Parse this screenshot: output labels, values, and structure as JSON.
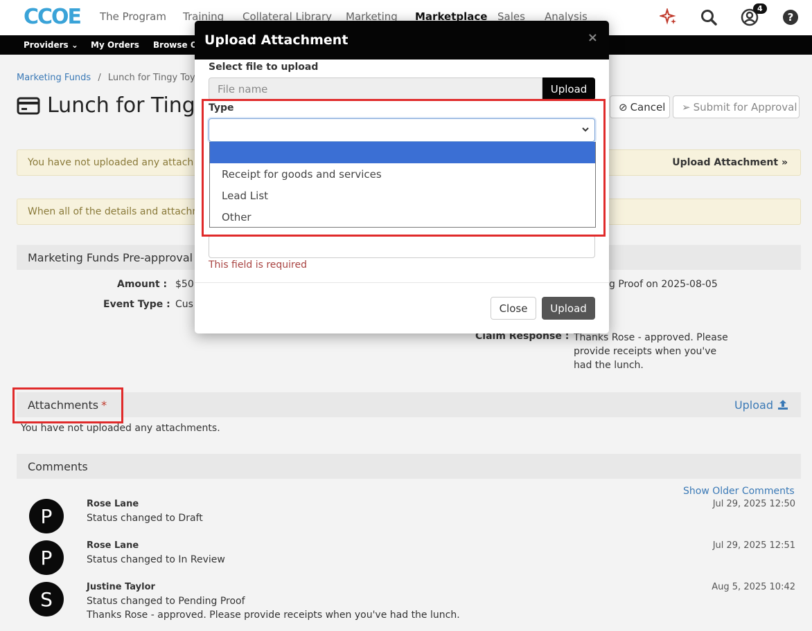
{
  "nav": {
    "logo": "CCOE",
    "items": [
      "The Program",
      "Training",
      "Collateral Library",
      "Marketing",
      "Marketplace",
      "Sales",
      "Analysis"
    ],
    "active": "Marketplace",
    "notification_count": "4"
  },
  "subnav": {
    "items": [
      "Providers",
      "My Orders",
      "Browse Of"
    ]
  },
  "breadcrumb": {
    "parent": "Marketing Funds",
    "separator": "/",
    "current": "Lunch for Tingy Toys"
  },
  "page": {
    "title": "Lunch for Tingy",
    "cancel_label": "Cancel",
    "submit_label": "Submit for Approval"
  },
  "alerts": {
    "attach_text": "You have not uploaded any attach",
    "attach_link": "Upload Attachment »",
    "details_text": "When all of the details and attachm"
  },
  "preapproval": {
    "heading": "Marketing Funds Pre-approval",
    "amount_label": "Amount :",
    "amount_value": "$50",
    "event_label": "Event Type :",
    "event_value": "Cus",
    "status_fragment": "g Proof on 2025-08-05",
    "claim_label": "Claim Response :",
    "claim_value": "Thanks Rose - approved. Please provide receipts when you've had the lunch."
  },
  "attachments": {
    "heading": "Attachments",
    "required_mark": "*",
    "upload_label": "Upload",
    "empty_text": "You have not uploaded any attachments."
  },
  "comments": {
    "heading": "Comments",
    "older_link": "Show Older Comments",
    "items": [
      {
        "initial": "P",
        "author": "Rose Lane",
        "text": "Status changed to Draft",
        "time": "Jul 29, 2025 12:50"
      },
      {
        "initial": "P",
        "author": "Rose Lane",
        "text": "Status changed to In Review",
        "time": "Jul 29, 2025 12:51"
      },
      {
        "initial": "S",
        "author": "Justine Taylor",
        "text": "Status changed to Pending Proof",
        "text2": "Thanks Rose - approved. Please provide receipts when you've had the lunch.",
        "time": "Aug 5, 2025 10:42"
      }
    ]
  },
  "modal": {
    "title": "Upload Attachment",
    "close_glyph": "×",
    "file_label": "Select file to upload",
    "file_placeholder": "File name",
    "file_button": "Upload",
    "type_label": "Type",
    "type_options": [
      "",
      "Receipt for goods and services",
      "Lead List",
      "Other"
    ],
    "required_msg": "This field is required",
    "close_button": "Close",
    "upload_button": "Upload"
  },
  "colors": {
    "header_black": "#050505",
    "highlight_red": "#e02a2a",
    "option_selected": "#3b6fd4",
    "link_blue": "#3a79b6"
  }
}
